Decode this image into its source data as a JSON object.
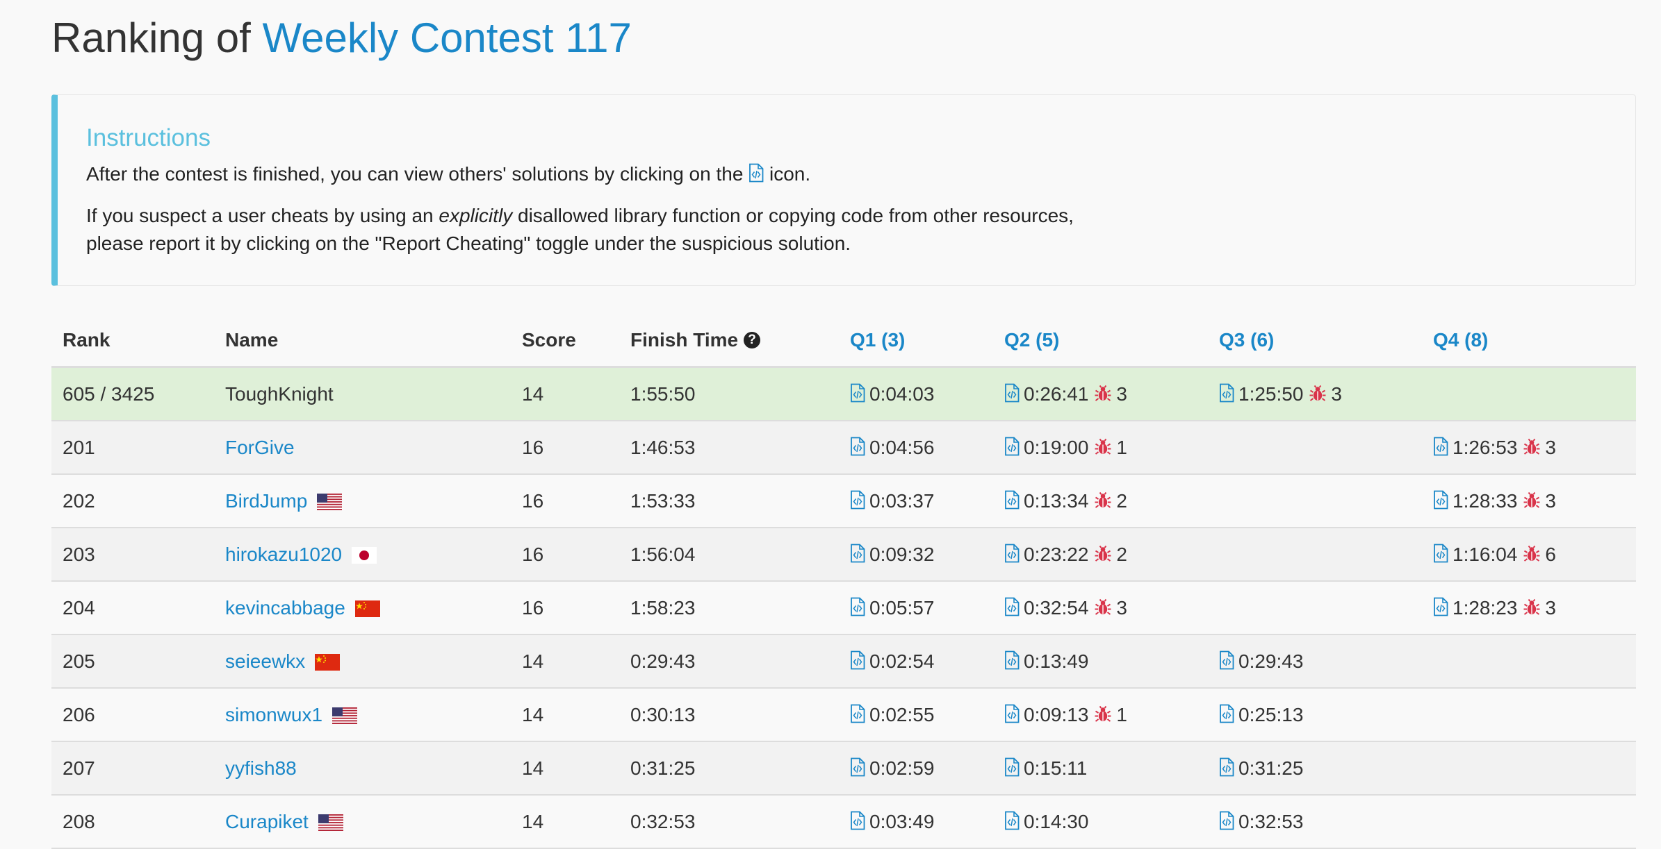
{
  "title": {
    "prefix": "Ranking of",
    "contest": "Weekly Contest 117"
  },
  "instructions": {
    "heading": "Instructions",
    "line1_before": "After the contest is finished, you can view others' solutions by clicking on the",
    "line1_after": "icon.",
    "line2_before": "If you suspect a user cheats by using an",
    "line2_em": "explicitly",
    "line2_after": "disallowed library function or copying code from other resources,",
    "line3": "please report it by clicking on the \"Report Cheating\" toggle under the suspicious solution."
  },
  "table": {
    "headers": {
      "rank": "Rank",
      "name": "Name",
      "score": "Score",
      "finish": "Finish Time",
      "q1": "Q1 (3)",
      "q2": "Q2 (5)",
      "q3": "Q3 (6)",
      "q4": "Q4 (8)"
    },
    "rows": [
      {
        "rank": "605 / 3425",
        "name": "ToughKnight",
        "flag": "",
        "score": "14",
        "finish": "1:55:50",
        "q1": {
          "time": "0:04:03",
          "bugs": ""
        },
        "q2": {
          "time": "0:26:41",
          "bugs": "3"
        },
        "q3": {
          "time": "1:25:50",
          "bugs": "3"
        },
        "q4": {
          "time": "",
          "bugs": ""
        }
      },
      {
        "rank": "201",
        "name": "ForGive",
        "flag": "",
        "score": "16",
        "finish": "1:46:53",
        "q1": {
          "time": "0:04:56",
          "bugs": ""
        },
        "q2": {
          "time": "0:19:00",
          "bugs": "1"
        },
        "q3": {
          "time": "",
          "bugs": ""
        },
        "q4": {
          "time": "1:26:53",
          "bugs": "3"
        }
      },
      {
        "rank": "202",
        "name": "BirdJump",
        "flag": "us",
        "score": "16",
        "finish": "1:53:33",
        "q1": {
          "time": "0:03:37",
          "bugs": ""
        },
        "q2": {
          "time": "0:13:34",
          "bugs": "2"
        },
        "q3": {
          "time": "",
          "bugs": ""
        },
        "q4": {
          "time": "1:28:33",
          "bugs": "3"
        }
      },
      {
        "rank": "203",
        "name": "hirokazu1020",
        "flag": "jp",
        "score": "16",
        "finish": "1:56:04",
        "q1": {
          "time": "0:09:32",
          "bugs": ""
        },
        "q2": {
          "time": "0:23:22",
          "bugs": "2"
        },
        "q3": {
          "time": "",
          "bugs": ""
        },
        "q4": {
          "time": "1:16:04",
          "bugs": "6"
        }
      },
      {
        "rank": "204",
        "name": "kevincabbage",
        "flag": "cn",
        "score": "16",
        "finish": "1:58:23",
        "q1": {
          "time": "0:05:57",
          "bugs": ""
        },
        "q2": {
          "time": "0:32:54",
          "bugs": "3"
        },
        "q3": {
          "time": "",
          "bugs": ""
        },
        "q4": {
          "time": "1:28:23",
          "bugs": "3"
        }
      },
      {
        "rank": "205",
        "name": "seieewkx",
        "flag": "cn",
        "score": "14",
        "finish": "0:29:43",
        "q1": {
          "time": "0:02:54",
          "bugs": ""
        },
        "q2": {
          "time": "0:13:49",
          "bugs": ""
        },
        "q3": {
          "time": "0:29:43",
          "bugs": ""
        },
        "q4": {
          "time": "",
          "bugs": ""
        }
      },
      {
        "rank": "206",
        "name": "simonwux1",
        "flag": "us",
        "score": "14",
        "finish": "0:30:13",
        "q1": {
          "time": "0:02:55",
          "bugs": ""
        },
        "q2": {
          "time": "0:09:13",
          "bugs": "1"
        },
        "q3": {
          "time": "0:25:13",
          "bugs": ""
        },
        "q4": {
          "time": "",
          "bugs": ""
        }
      },
      {
        "rank": "207",
        "name": "yyfish88",
        "flag": "",
        "score": "14",
        "finish": "0:31:25",
        "q1": {
          "time": "0:02:59",
          "bugs": ""
        },
        "q2": {
          "time": "0:15:11",
          "bugs": ""
        },
        "q3": {
          "time": "0:31:25",
          "bugs": ""
        },
        "q4": {
          "time": "",
          "bugs": ""
        }
      },
      {
        "rank": "208",
        "name": "Curapiket",
        "flag": "us",
        "score": "14",
        "finish": "0:32:53",
        "q1": {
          "time": "0:03:49",
          "bugs": ""
        },
        "q2": {
          "time": "0:14:30",
          "bugs": ""
        },
        "q3": {
          "time": "0:32:53",
          "bugs": ""
        },
        "q4": {
          "time": "",
          "bugs": ""
        }
      }
    ]
  },
  "colors": {
    "link": "#1a87c8",
    "accent": "#5bc0de",
    "bug": "#d9344a",
    "highlight_row": "#dff0d8"
  },
  "icons": {
    "solution": "code-file-icon",
    "bug": "bug-icon",
    "help": "question-circle-icon"
  }
}
